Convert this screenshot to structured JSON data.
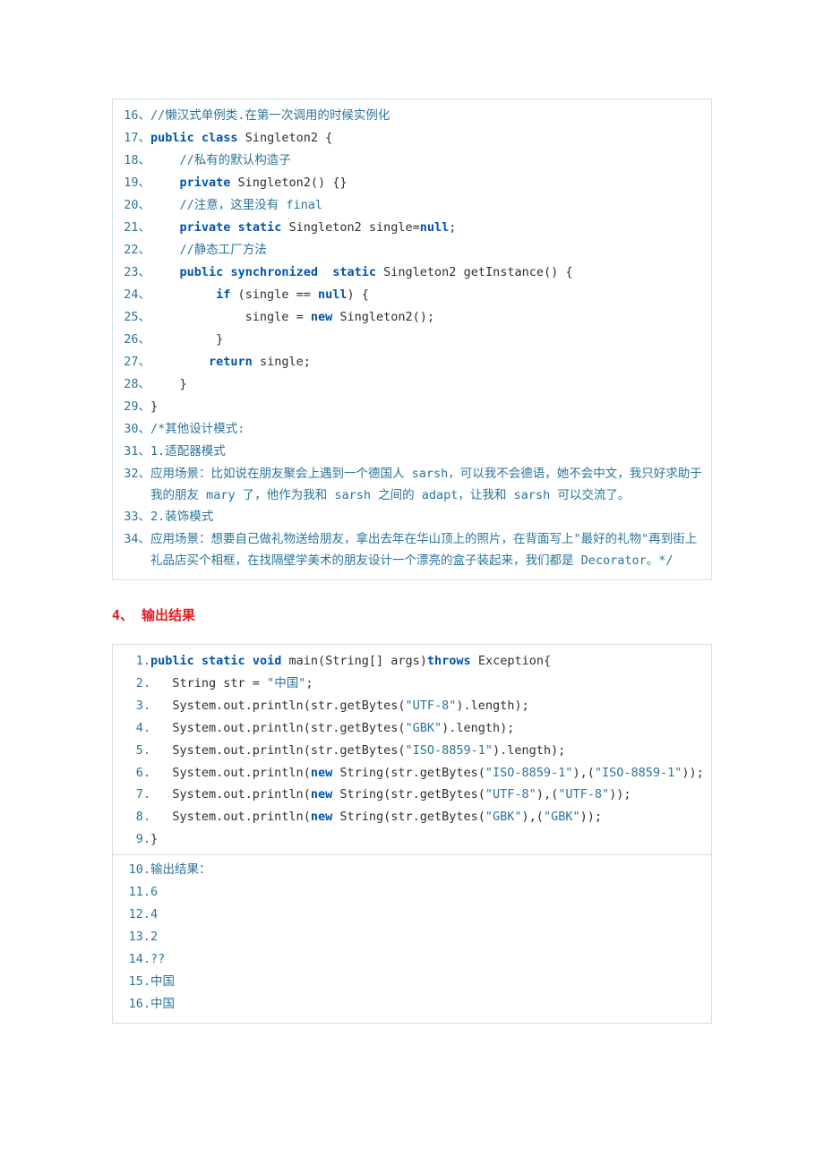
{
  "block1": {
    "lines": [
      {
        "n": "16、",
        "tokens": [
          [
            "cm",
            "//懒汉式单例类.在第一次调用的时候实例化"
          ]
        ]
      },
      {
        "n": "17、",
        "tokens": [
          [
            "kw",
            "public"
          ],
          [
            "pl",
            " "
          ],
          [
            "kw",
            "class"
          ],
          [
            "pl",
            " Singleton2 {"
          ]
        ]
      },
      {
        "n": "18、",
        "tokens": [
          [
            "pl",
            "    "
          ],
          [
            "cm",
            "//私有的默认构造子"
          ]
        ]
      },
      {
        "n": "19、",
        "tokens": [
          [
            "pl",
            "    "
          ],
          [
            "kw",
            "private"
          ],
          [
            "pl",
            " Singleton2() {}"
          ]
        ]
      },
      {
        "n": "20、",
        "tokens": [
          [
            "pl",
            "    "
          ],
          [
            "cm",
            "//注意，这里没有 final"
          ]
        ]
      },
      {
        "n": "21、",
        "tokens": [
          [
            "pl",
            "    "
          ],
          [
            "kw",
            "private"
          ],
          [
            "pl",
            " "
          ],
          [
            "kw",
            "static"
          ],
          [
            "pl",
            " Singleton2 single="
          ],
          [
            "kw",
            "null"
          ],
          [
            "pl",
            ";"
          ]
        ]
      },
      {
        "n": "22、",
        "tokens": [
          [
            "pl",
            "    "
          ],
          [
            "cm",
            "//静态工厂方法"
          ]
        ]
      },
      {
        "n": "23、",
        "tokens": [
          [
            "pl",
            "    "
          ],
          [
            "kw",
            "public"
          ],
          [
            "pl",
            " "
          ],
          [
            "kw",
            "synchronized"
          ],
          [
            "pl",
            "  "
          ],
          [
            "kw",
            "static"
          ],
          [
            "pl",
            " Singleton2 getInstance() {"
          ]
        ]
      },
      {
        "n": "24、",
        "tokens": [
          [
            "pl",
            "         "
          ],
          [
            "kw",
            "if"
          ],
          [
            "pl",
            " (single == "
          ],
          [
            "kw",
            "null"
          ],
          [
            "pl",
            ") {"
          ]
        ]
      },
      {
        "n": "25、",
        "tokens": [
          [
            "pl",
            "             single = "
          ],
          [
            "kw",
            "new"
          ],
          [
            "pl",
            " Singleton2();"
          ]
        ]
      },
      {
        "n": "26、",
        "tokens": [
          [
            "pl",
            "         }"
          ]
        ]
      },
      {
        "n": "27、",
        "tokens": [
          [
            "pl",
            "        "
          ],
          [
            "kw",
            "return"
          ],
          [
            "pl",
            " single;"
          ]
        ]
      },
      {
        "n": "28、",
        "tokens": [
          [
            "pl",
            "    }"
          ]
        ]
      },
      {
        "n": "29、",
        "tokens": [
          [
            "pl",
            "}"
          ]
        ]
      },
      {
        "n": "30、",
        "tokens": [
          [
            "cm",
            "/*其他设计模式:"
          ]
        ]
      },
      {
        "n": "31、",
        "tokens": [
          [
            "cm",
            "1.适配器模式"
          ]
        ]
      },
      {
        "n": "32、",
        "wrap": "应用场景：比如说在朋友聚会上遇到一个德国人 sarsh，可以我不会德语，她不会中文，我只好求助于我的朋友 mary 了，他作为我和 sarsh 之间的 adapt，让我和 sarsh 可以交流了。"
      },
      {
        "n": "33、",
        "tokens": [
          [
            "cm",
            "2.装饰模式"
          ]
        ]
      },
      {
        "n": "34、",
        "wrap": "应用场景：想要自己做礼物送给朋友，拿出去年在华山顶上的照片，在背面写上\"最好的礼物\"再到街上礼品店买个相框，在找隔壁学美术的朋友设计一个漂亮的盒子装起来，我们都是 Decorator。*/"
      }
    ]
  },
  "heading": "4、 输出结果",
  "block2": {
    "lines": [
      {
        "n": "1.",
        "tokens": [
          [
            "kw",
            "public"
          ],
          [
            "pl",
            " "
          ],
          [
            "kw",
            "static"
          ],
          [
            "pl",
            " "
          ],
          [
            "kw",
            "void"
          ],
          [
            "pl",
            " main(String[] args)"
          ],
          [
            "kw",
            "throws"
          ],
          [
            "pl",
            " Exception{"
          ]
        ]
      },
      {
        "n": "2.",
        "tokens": [
          [
            "pl",
            "   String str = "
          ],
          [
            "str",
            "\"中国\""
          ],
          [
            "pl",
            ";"
          ]
        ]
      },
      {
        "n": "3.",
        "tokens": [
          [
            "pl",
            "   System.out.println(str.getBytes("
          ],
          [
            "str",
            "\"UTF-8\""
          ],
          [
            "pl",
            ").length);"
          ]
        ]
      },
      {
        "n": "4.",
        "tokens": [
          [
            "pl",
            "   System.out.println(str.getBytes("
          ],
          [
            "str",
            "\"GBK\""
          ],
          [
            "pl",
            ").length);"
          ]
        ]
      },
      {
        "n": "5.",
        "tokens": [
          [
            "pl",
            "   System.out.println(str.getBytes("
          ],
          [
            "str",
            "\"ISO-8859-1\""
          ],
          [
            "pl",
            ").length);"
          ]
        ]
      },
      {
        "n": "6.",
        "tokens": [
          [
            "pl",
            "   System.out.println("
          ],
          [
            "kw",
            "new"
          ],
          [
            "pl",
            " String(str.getBytes("
          ],
          [
            "str",
            "\"ISO-8859-1\""
          ],
          [
            "pl",
            "),("
          ],
          [
            "str",
            "\"ISO-8859-1\""
          ],
          [
            "pl",
            "));"
          ]
        ]
      },
      {
        "n": "7.",
        "tokens": [
          [
            "pl",
            "   System.out.println("
          ],
          [
            "kw",
            "new"
          ],
          [
            "pl",
            " String(str.getBytes("
          ],
          [
            "str",
            "\"UTF-8\""
          ],
          [
            "pl",
            "),("
          ],
          [
            "str",
            "\"UTF-8\""
          ],
          [
            "pl",
            "));"
          ]
        ]
      },
      {
        "n": "8.",
        "tokens": [
          [
            "pl",
            "   System.out.println("
          ],
          [
            "kw",
            "new"
          ],
          [
            "pl",
            " String(str.getBytes("
          ],
          [
            "str",
            "\"GBK\""
          ],
          [
            "pl",
            "),("
          ],
          [
            "str",
            "\"GBK\""
          ],
          [
            "pl",
            "));"
          ]
        ]
      },
      {
        "n": "9.",
        "tokens": [
          [
            "pl",
            "}"
          ]
        ]
      },
      {
        "separator": true
      },
      {
        "n": "10.",
        "tokens": [
          [
            "cm",
            "输出结果："
          ]
        ]
      },
      {
        "n": "11.",
        "tokens": [
          [
            "cm",
            "6"
          ]
        ]
      },
      {
        "n": "12.",
        "tokens": [
          [
            "cm",
            "4"
          ]
        ]
      },
      {
        "n": "13.",
        "tokens": [
          [
            "cm",
            "2"
          ]
        ]
      },
      {
        "n": "14.",
        "tokens": [
          [
            "cm",
            "??"
          ]
        ]
      },
      {
        "n": "15.",
        "tokens": [
          [
            "cm",
            "中国"
          ]
        ]
      },
      {
        "n": "16.",
        "tokens": [
          [
            "cm",
            "中国"
          ]
        ]
      }
    ]
  }
}
